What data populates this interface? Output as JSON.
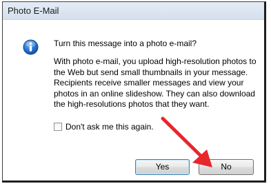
{
  "dialog": {
    "title": "Photo E-Mail",
    "icon": "info-icon",
    "question": "Turn this message into a photo e-mail?",
    "description": "With photo e-mail, you upload high-resolution photos to the Web but send small thumbnails in your message. Recipients receive smaller messages and view your photos in an online slideshow. They can also download the high-resolutions photos that they want.",
    "checkbox": {
      "label": "Don't ask me this again.",
      "checked": false
    },
    "buttons": {
      "yes": "Yes",
      "no": "No"
    }
  },
  "annotation": {
    "type": "arrow",
    "color": "#e8262c",
    "points_to": "no-button"
  }
}
